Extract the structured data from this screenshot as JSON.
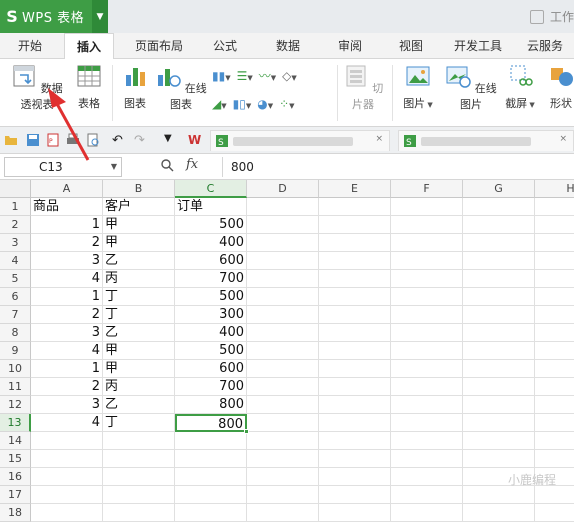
{
  "app": {
    "name": "WPS 表格",
    "logo": "S",
    "title_right": "工作"
  },
  "tabs": [
    "开始",
    "插入",
    "页面布局",
    "公式",
    "数据",
    "审阅",
    "视图",
    "开发工具",
    "云服务"
  ],
  "active_tab": "插入",
  "ribbon": {
    "pivot_table": "数据透视表",
    "table": "表格",
    "chart": "图表",
    "online_chart": "在线图表",
    "slicer": "切片器",
    "picture": "图片",
    "online_picture": "在线图片",
    "screenshot": "截屏",
    "shape": "形状"
  },
  "formula_bar": {
    "name_box": "C13",
    "fx": "fx",
    "value": "800"
  },
  "sheet": {
    "columns": [
      "A",
      "B",
      "C",
      "D",
      "E",
      "F",
      "G",
      "H"
    ],
    "selected_column": "C",
    "selected_row": 13,
    "row_numbers": [
      "1",
      "2",
      "3",
      "4",
      "5",
      "6",
      "7",
      "8",
      "9",
      "10",
      "11",
      "12",
      "13",
      "14",
      "15",
      "16",
      "17",
      "18"
    ],
    "header": [
      "商品",
      "客户",
      "订单"
    ],
    "rows": [
      [
        "1",
        "甲",
        "500"
      ],
      [
        "2",
        "甲",
        "400"
      ],
      [
        "3",
        "乙",
        "600"
      ],
      [
        "4",
        "丙",
        "700"
      ],
      [
        "1",
        "丁",
        "500"
      ],
      [
        "2",
        "丁",
        "300"
      ],
      [
        "3",
        "乙",
        "400"
      ],
      [
        "4",
        "甲",
        "500"
      ],
      [
        "1",
        "甲",
        "600"
      ],
      [
        "2",
        "丙",
        "700"
      ],
      [
        "3",
        "乙",
        "800"
      ],
      [
        "4",
        "丁",
        "800"
      ]
    ]
  },
  "watermark": "小鹿编程"
}
